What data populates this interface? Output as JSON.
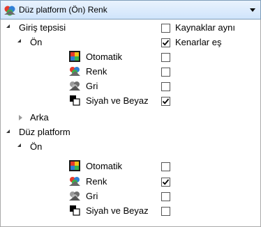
{
  "dropdown": {
    "label": "Düz platform (Ön) Renk",
    "icon": "color-scan-icon"
  },
  "tree": {
    "giris_tepsisi": {
      "label": "Giriş tepsisi",
      "on": {
        "label": "Ön",
        "items": [
          {
            "label": "Otomatik",
            "icon": "auto-mode-icon",
            "checked": false
          },
          {
            "label": "Renk",
            "icon": "color-mode-icon",
            "checked": false
          },
          {
            "label": "Gri",
            "icon": "gray-mode-icon",
            "checked": false
          },
          {
            "label": "Siyah ve Beyaz",
            "icon": "bw-mode-icon",
            "checked": true
          }
        ]
      },
      "arka": {
        "label": "Arka"
      }
    },
    "duz_platform": {
      "label": "Düz platform",
      "on": {
        "label": "Ön",
        "items": [
          {
            "label": "Otomatik",
            "icon": "auto-mode-icon",
            "checked": false
          },
          {
            "label": "Renk",
            "icon": "color-mode-icon",
            "checked": true
          },
          {
            "label": "Gri",
            "icon": "gray-mode-icon",
            "checked": false
          },
          {
            "label": "Siyah ve Beyaz",
            "icon": "bw-mode-icon",
            "checked": false
          }
        ]
      }
    }
  },
  "options": {
    "kaynaklar_ayni": {
      "label": "Kaynaklar aynı",
      "checked": false
    },
    "kenarlar_es": {
      "label": "Kenarlar eş",
      "checked": true
    }
  }
}
